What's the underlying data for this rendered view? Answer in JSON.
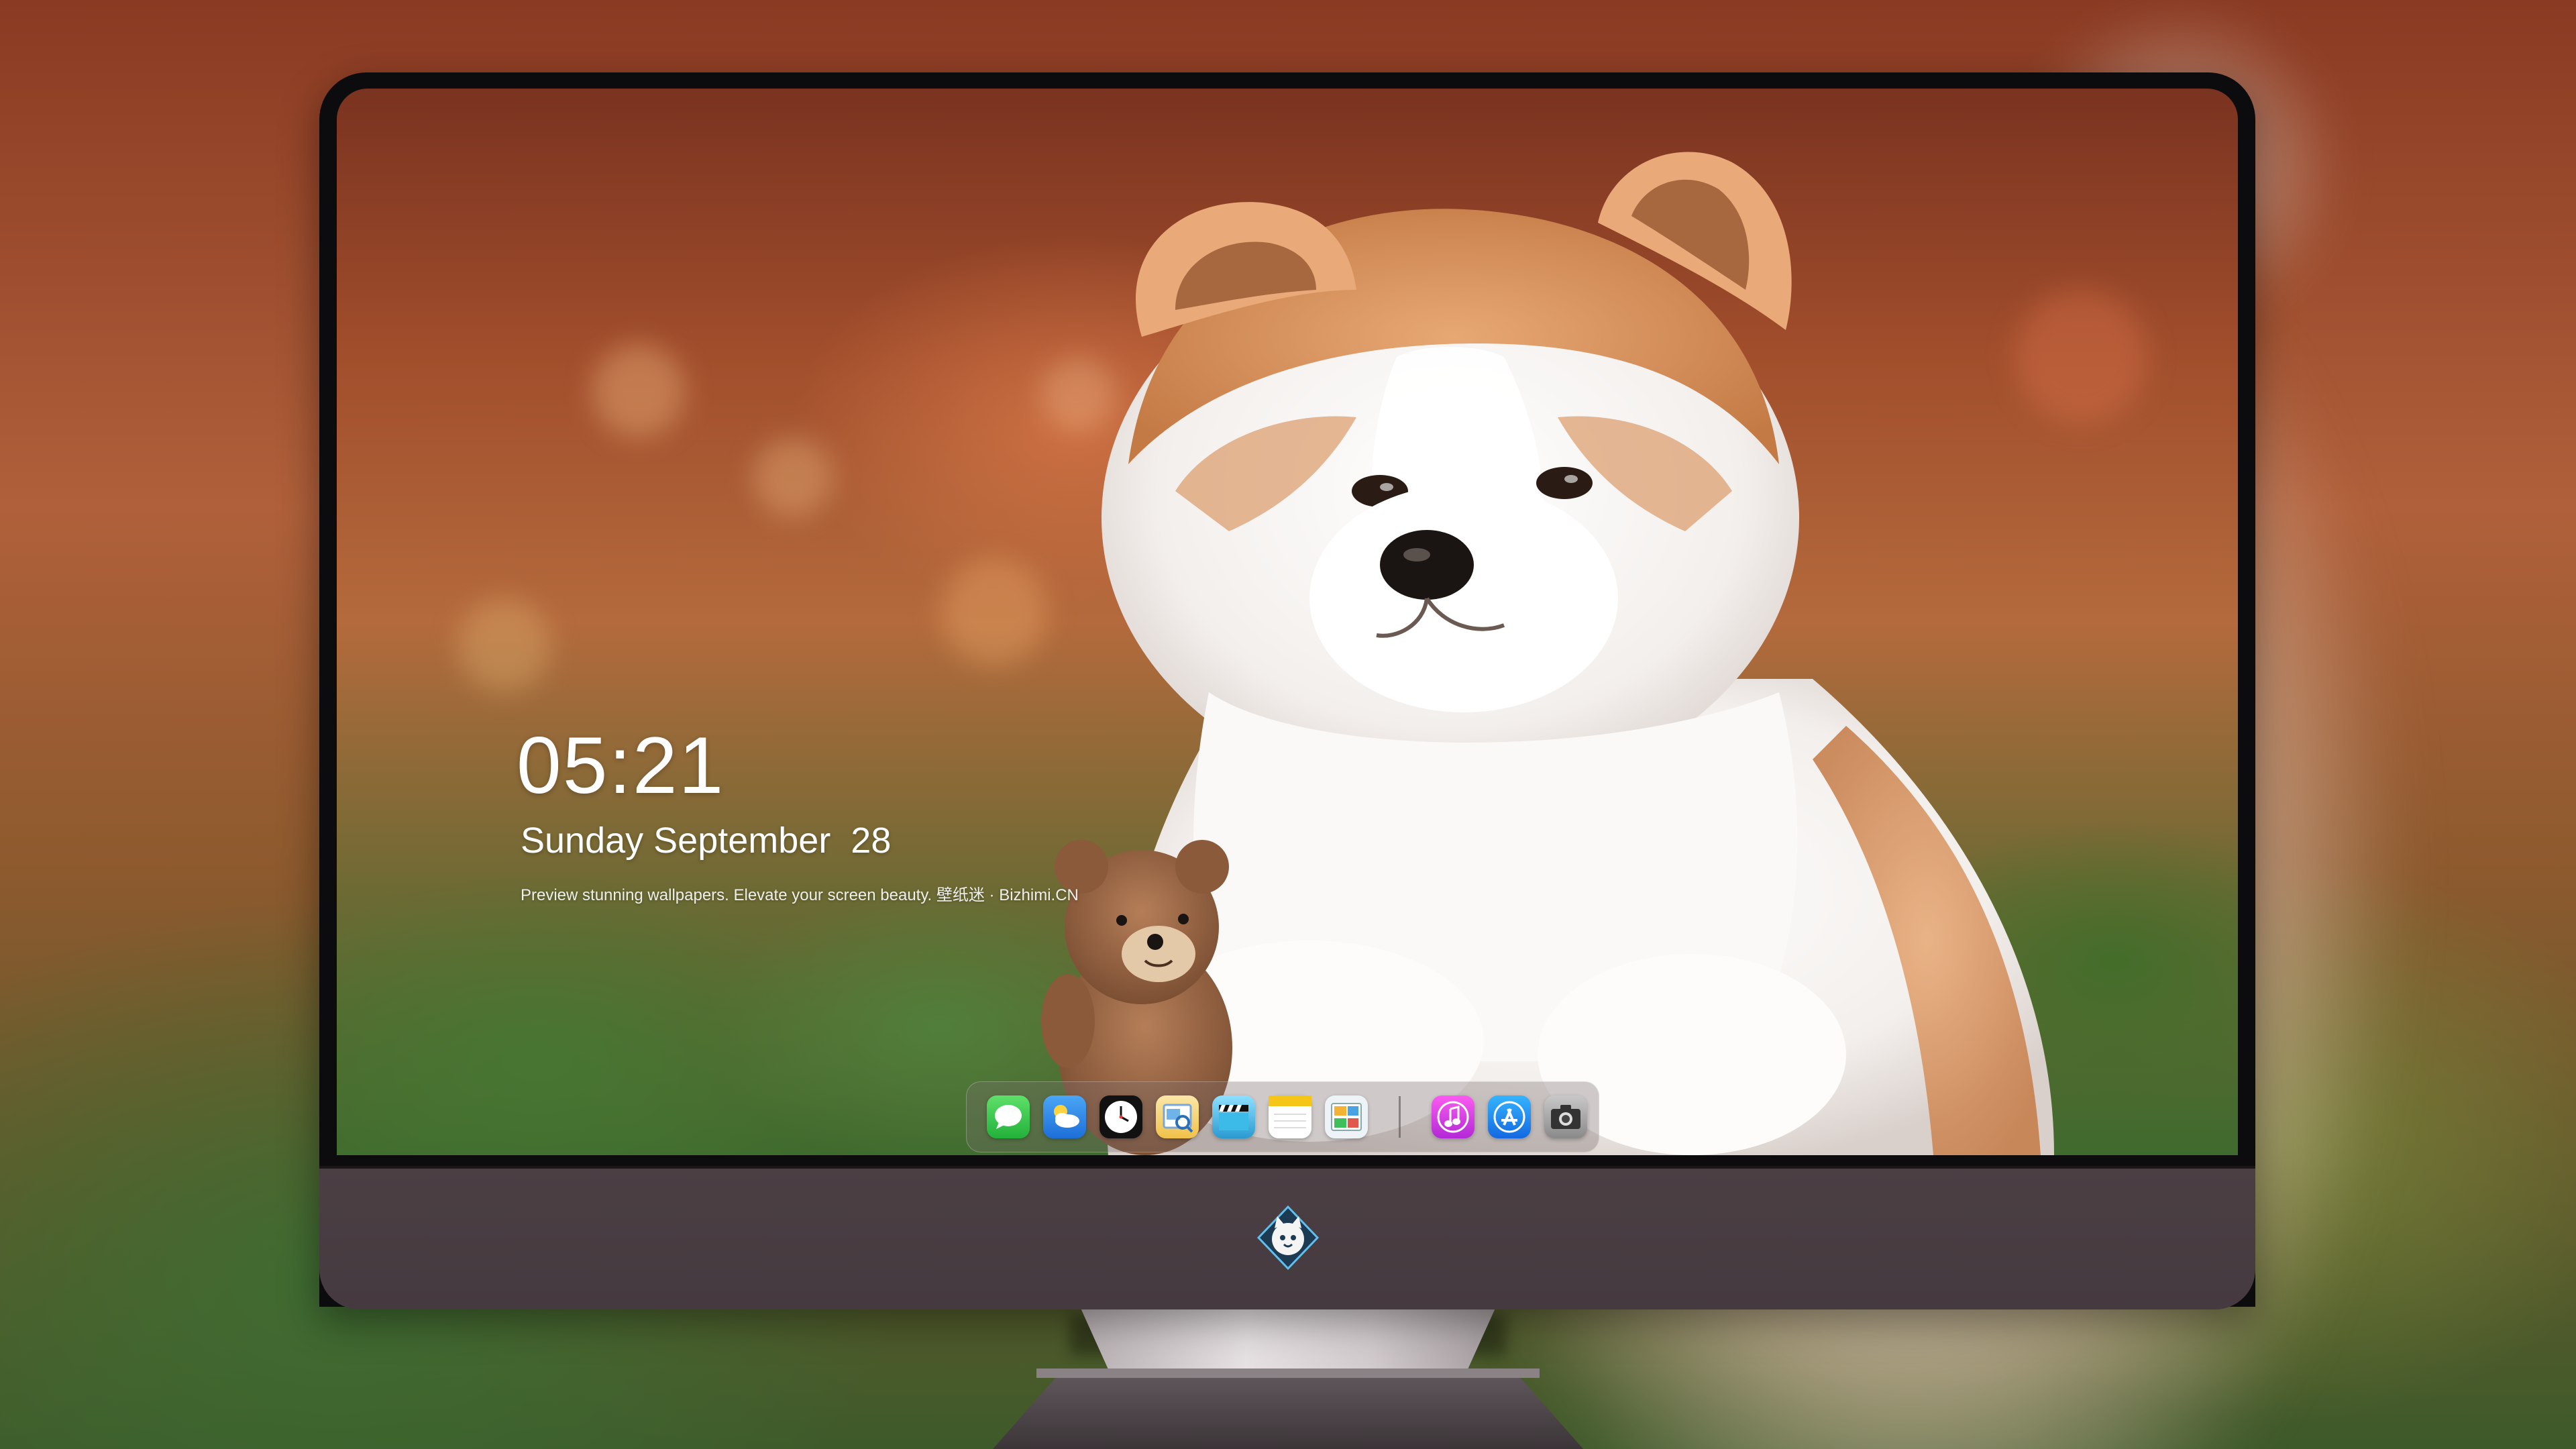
{
  "lock_screen": {
    "time": "05:21",
    "date": "Sunday September  28",
    "tagline": "Preview stunning wallpapers. Elevate your screen beauty. 壁纸迷 · Bizhimi.CN"
  },
  "dock": {
    "apps": [
      {
        "name": "messages",
        "icon": "messages-icon",
        "color": "#3ecf4a"
      },
      {
        "name": "weather",
        "icon": "weather-icon",
        "color": "#2f8fe8"
      },
      {
        "name": "clock",
        "icon": "clock-icon",
        "color": "#111111"
      },
      {
        "name": "preview",
        "icon": "preview-icon",
        "color": "#f4c542"
      },
      {
        "name": "video-editor",
        "icon": "clapperboard-icon",
        "color": "#3aa6d8"
      },
      {
        "name": "notes",
        "icon": "notes-icon",
        "color": "#f5c518"
      },
      {
        "name": "photo-gallery",
        "icon": "photo-gallery-icon",
        "color": "#5a9be0"
      },
      {
        "name": "music",
        "icon": "music-icon",
        "color": "#e23ad4"
      },
      {
        "name": "app-store",
        "icon": "app-store-icon",
        "color": "#1e8cf0"
      },
      {
        "name": "camera",
        "icon": "camera-icon",
        "color": "#9a9a9a"
      }
    ]
  },
  "monitor": {
    "brand_logo": "cat-mascot-logo-icon"
  }
}
